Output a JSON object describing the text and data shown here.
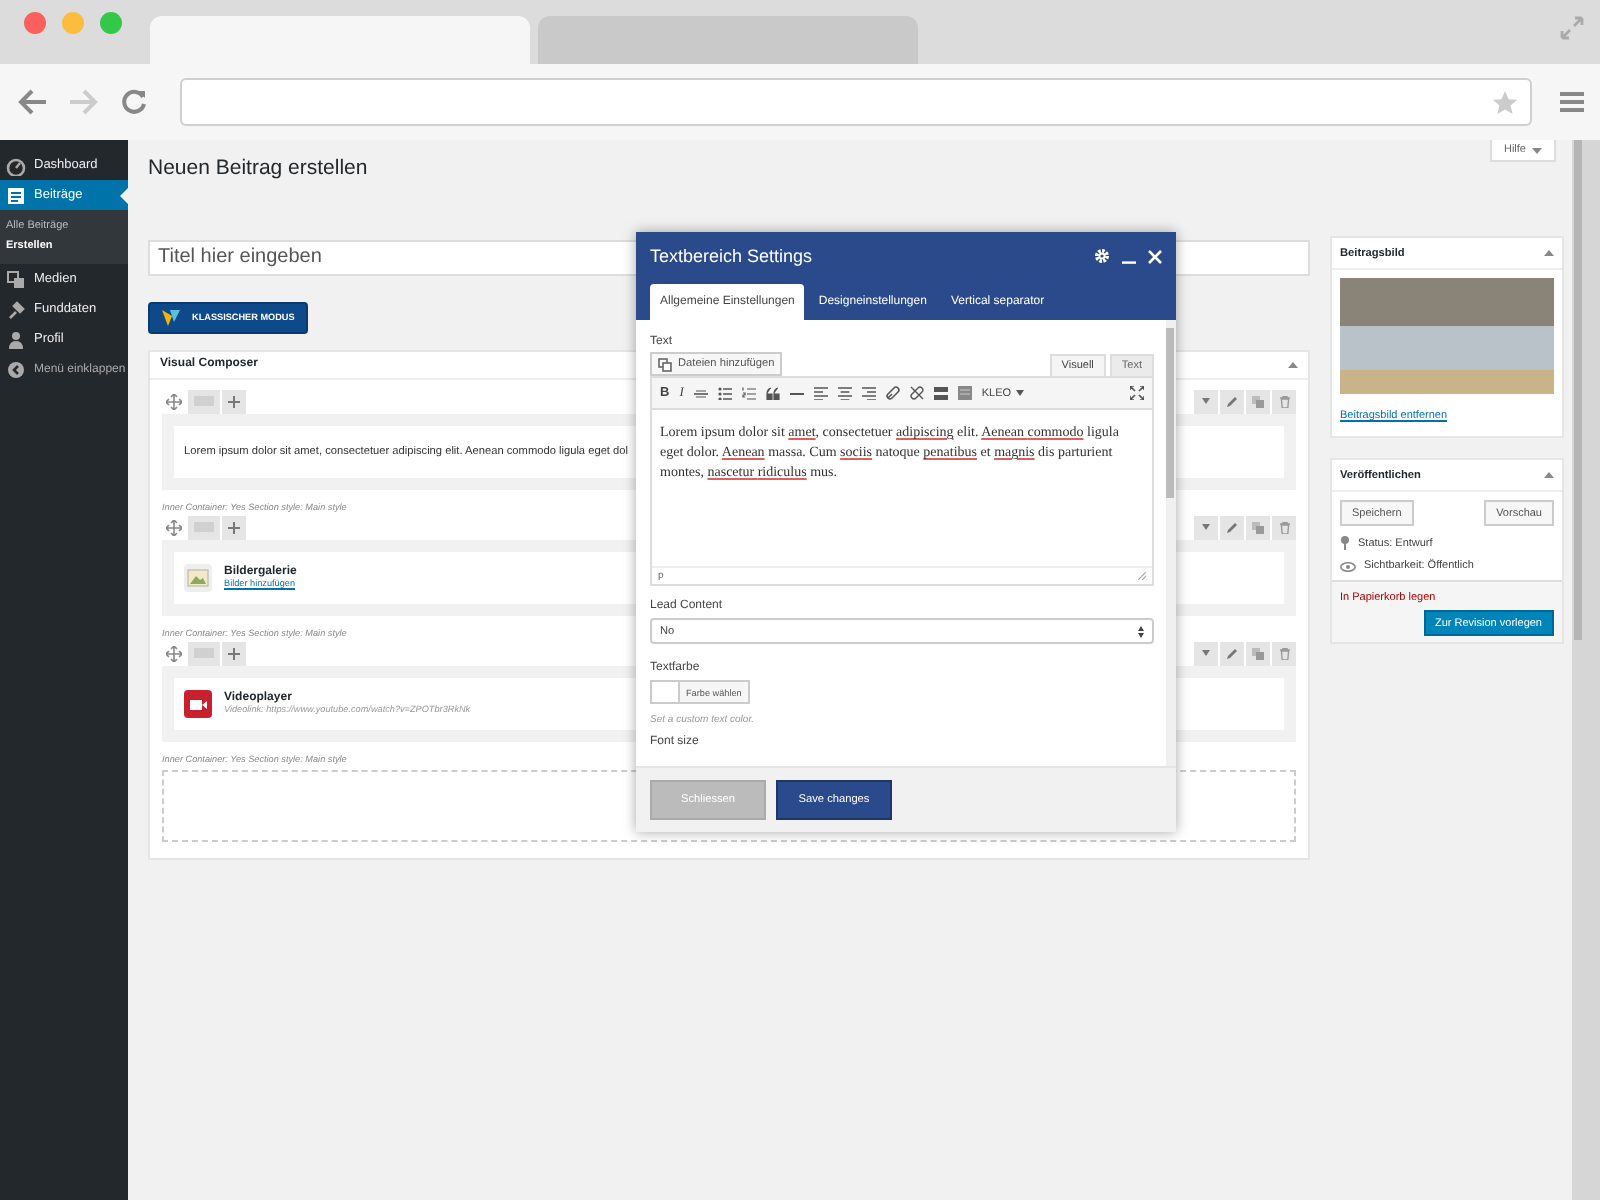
{
  "browser": {
    "tabs": [
      {
        "selected": true
      },
      {
        "selected": false
      }
    ]
  },
  "sidebar": {
    "items": [
      {
        "label": "Dashboard",
        "selected": false,
        "kind": "menu"
      },
      {
        "label": "Beiträge",
        "selected": true,
        "kind": "menu",
        "children": [
          {
            "label": "Alle Beiträge",
            "selected": false
          },
          {
            "label": "Erstellen",
            "selected": true
          }
        ]
      },
      {
        "label": "Medien",
        "selected": false,
        "kind": "menu"
      },
      {
        "label": "Funddaten",
        "selected": false,
        "kind": "menu"
      },
      {
        "label": "Profil",
        "selected": false,
        "kind": "menu"
      },
      {
        "label": "Menü einklappen",
        "selected": false,
        "kind": "collapse"
      }
    ]
  },
  "page": {
    "title": "Neuen Beitrag erstellen",
    "help_button": "Hilfe"
  },
  "title_field": {
    "placeholder": "Titel hier eingeben"
  },
  "classic_mode_button": "KLASSISCHER MODUS",
  "visual_composer": {
    "title": "Visual Composer",
    "sections": [
      {
        "kind": "text",
        "text": "Lorem ipsum dolor sit amet, consectetuer adipiscing elit. Aenean commodo ligula eget dol"
      },
      {
        "kind": "gallery",
        "meta": "Inner Container: Yes  Section style: Main style",
        "title": "Bildergalerie",
        "subtitle": "Bilder hinzufügen"
      },
      {
        "kind": "video",
        "meta": "Inner Container: Yes  Section style: Main style",
        "title": "Videoplayer",
        "subtitle": "Videolink: https://www.youtube.com/watch?v=ZPOTbr3RkNk"
      },
      {
        "kind": "empty",
        "meta": "Inner Container: Yes  Section style: Main style"
      }
    ]
  },
  "featured_image": {
    "title": "Beitragsbild",
    "remove_link": "Beitragsbild entfernen"
  },
  "publish": {
    "title": "Veröffentlichen",
    "save_button": "Speichern",
    "preview_button": "Vorschau",
    "status": "Status: Entwurf",
    "visibility": "Sichtbarkeit: Öffentlich",
    "trash_link": "In Papierkorb legen",
    "submit_button": "Zur Revision vorlegen"
  },
  "modal": {
    "title": "Textbereich Settings",
    "tabs": [
      {
        "label": "Allgemeine Einstellungen",
        "selected": true
      },
      {
        "label": "Designeinstellungen",
        "selected": false
      },
      {
        "label": "Vertical separator",
        "selected": false
      }
    ],
    "text_label": "Text",
    "add_media_button": "Dateien hinzufügen",
    "editor_tabs": [
      {
        "label": "Visuell",
        "selected": true
      },
      {
        "label": "Text",
        "selected": false
      }
    ],
    "toolbar": {
      "bold": "B",
      "italic": "I",
      "format": "KLEO"
    },
    "content": [
      {
        "text": "Lorem ipsum dolor sit ",
        "misspelled": false
      },
      {
        "text": "amet",
        "misspelled": true
      },
      {
        "text": ", consectetuer ",
        "misspelled": false
      },
      {
        "text": "adipiscing",
        "misspelled": true
      },
      {
        "text": " elit. ",
        "misspelled": false
      },
      {
        "text": "Aenean ",
        "misspelled": true
      },
      {
        "text": "commodo",
        "misspelled": true
      },
      {
        "text": " ligula eget dolor. ",
        "misspelled": false
      },
      {
        "text": "Aenean",
        "misspelled": true
      },
      {
        "text": " massa. Cum ",
        "misspelled": false
      },
      {
        "text": "sociis",
        "misspelled": true
      },
      {
        "text": " natoque ",
        "misspelled": false
      },
      {
        "text": "penatibus",
        "misspelled": true
      },
      {
        "text": " et ",
        "misspelled": false
      },
      {
        "text": "magnis",
        "misspelled": true
      },
      {
        "text": " dis parturient montes, ",
        "misspelled": false
      },
      {
        "text": "nascetur ",
        "misspelled": true
      },
      {
        "text": "ridiculus",
        "misspelled": true
      },
      {
        "text": " mus.",
        "misspelled": false
      }
    ],
    "path": "p",
    "lead_content": {
      "label": "Lead Content",
      "value": "No"
    },
    "text_color": {
      "label": "Textfarbe",
      "button": "Farbe wählen",
      "hint": "Set a custom text color."
    },
    "font_size_label": "Font size",
    "buttons": {
      "close": "Schliessen",
      "save": "Save changes"
    }
  }
}
